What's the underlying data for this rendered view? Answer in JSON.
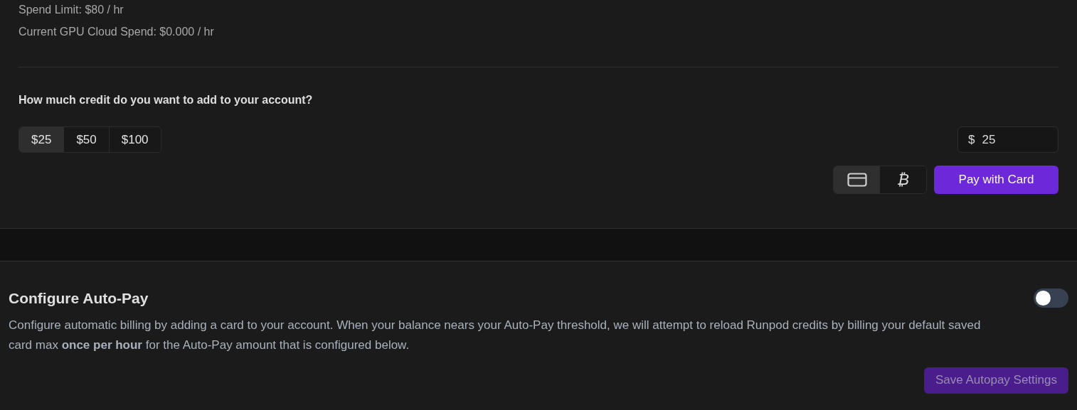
{
  "usage": {
    "spend_limit": "Spend Limit: $80 / hr",
    "current_spend": "Current GPU Cloud Spend: $0.000 / hr"
  },
  "add_credit": {
    "question": "How much credit do you want to add to your account?",
    "amounts": [
      {
        "label": "$25",
        "selected": true
      },
      {
        "label": "$50",
        "selected": false
      },
      {
        "label": "$100",
        "selected": false
      }
    ],
    "custom_amount": {
      "prefix": "$",
      "value": "25"
    },
    "payment_methods": [
      {
        "kind": "card",
        "selected": true
      },
      {
        "kind": "bitcoin",
        "selected": false,
        "icon": "₿"
      }
    ],
    "pay_button": "Pay with Card"
  },
  "autopay": {
    "title": "Configure Auto-Pay",
    "enabled": false,
    "description": "Configure automatic billing by adding a card to your account. When your balance nears your Auto-Pay threshold, we will attempt to reload Runpod credits by billing your default saved card max **once per hour** for the Auto-Pay amount that is configured below.",
    "save_button": {
      "label": "Save Autopay Settings",
      "disabled": true
    }
  }
}
